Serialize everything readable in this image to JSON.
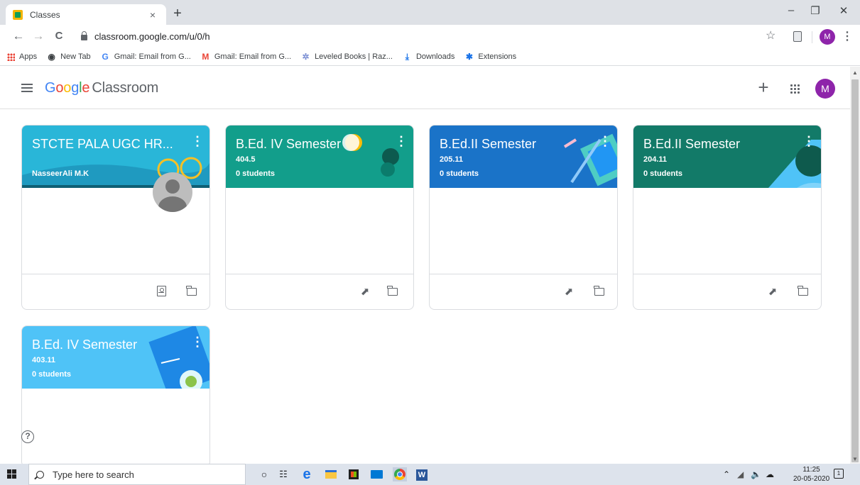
{
  "browser": {
    "tab_title": "Classes",
    "tab_close": "×",
    "new_tab": "+",
    "url": "classroom.google.com/u/0/h",
    "profile_initial": "M",
    "win_minimize": "–",
    "win_restore": "❐",
    "win_close": "✕",
    "back": "←",
    "forward": "→",
    "reload": "C",
    "star": "☆",
    "menu": "⋮"
  },
  "bookmarks": [
    {
      "label": "Apps",
      "icon": "apps-grid-icon"
    },
    {
      "label": "New Tab",
      "icon": "globe-icon"
    },
    {
      "label": "Gmail: Email from G...",
      "icon": "google-g-icon"
    },
    {
      "label": "Gmail: Email from G...",
      "icon": "gmail-m-icon"
    },
    {
      "label": "Leveled Books | Raz...",
      "icon": "raz-icon"
    },
    {
      "label": "Downloads",
      "icon": "download-icon"
    },
    {
      "label": "Extensions",
      "icon": "puzzle-icon"
    }
  ],
  "header": {
    "logo_letters": [
      "G",
      "o",
      "o",
      "g",
      "l",
      "e"
    ],
    "product": "Classroom",
    "add_symbol": "+",
    "avatar_initial": "M"
  },
  "classes": [
    {
      "title": "STCTE PALA UGC HR...",
      "section": "",
      "students": "",
      "owner": "NasseerAli M.K",
      "theme": "#29b6d8",
      "footer": [
        "portfolio",
        "folder"
      ]
    },
    {
      "title": "B.Ed. IV Semester",
      "section": "404.5",
      "students": "0 students",
      "owner": "",
      "theme": "#129e8b",
      "footer": [
        "trend",
        "folder"
      ]
    },
    {
      "title": "B.Ed.II Semester",
      "section": "205.11",
      "students": "0 students",
      "owner": "",
      "theme": "#1a73c8",
      "footer": [
        "trend",
        "folder"
      ]
    },
    {
      "title": "B.Ed.II Semester",
      "section": "204.11",
      "students": "0 students",
      "owner": "",
      "theme": "#127a68",
      "footer": [
        "trend",
        "folder"
      ]
    },
    {
      "title": "B.Ed. IV Semester",
      "section": "403.11",
      "students": "0 students",
      "owner": "",
      "theme": "#4fc3f7",
      "footer": []
    }
  ],
  "help_symbol": "?",
  "taskbar": {
    "search_placeholder": "Type here to search",
    "time": "11:25",
    "date": "20-05-2020",
    "apps": [
      "cortana-icon",
      "task-view-icon",
      "edge-icon",
      "file-explorer-icon",
      "store-icon",
      "mail-icon",
      "chrome-icon",
      "word-icon"
    ]
  },
  "colors": {
    "accent_purple": "#8e24aa",
    "google_blue": "#4285f4",
    "google_red": "#ea4335",
    "google_yellow": "#fbbc05",
    "google_green": "#34a853"
  }
}
